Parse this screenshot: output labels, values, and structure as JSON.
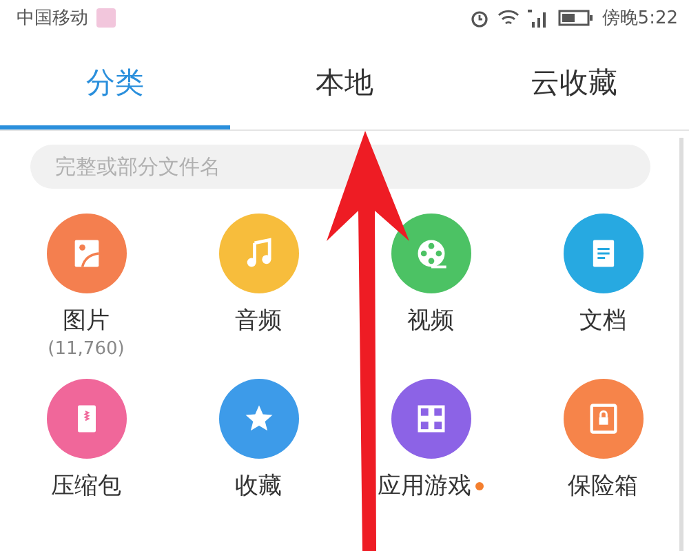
{
  "status_bar": {
    "carrier": "中国移动",
    "time": "傍晚5:22"
  },
  "tabs": [
    {
      "label": "分类",
      "selected": true
    },
    {
      "label": "本地",
      "selected": false
    },
    {
      "label": "云收藏",
      "selected": false
    }
  ],
  "search": {
    "placeholder": "完整或部分文件名"
  },
  "categories": [
    {
      "kind": "image",
      "label": "图片",
      "count": "(11,760)",
      "color": "#f47f4f",
      "new_badge": false
    },
    {
      "kind": "music",
      "label": "音频",
      "color": "#f7bd3c",
      "new_badge": false
    },
    {
      "kind": "video",
      "label": "视频",
      "color": "#4cc264",
      "new_badge": false
    },
    {
      "kind": "document",
      "label": "文档",
      "color": "#27a9e1",
      "new_badge": false
    },
    {
      "kind": "archive",
      "label": "压缩包",
      "color": "#f0679a",
      "new_badge": false
    },
    {
      "kind": "star",
      "label": "收藏",
      "color": "#3d9be9",
      "new_badge": false
    },
    {
      "kind": "apps",
      "label": "应用游戏",
      "color": "#8c63e6",
      "new_badge": true
    },
    {
      "kind": "safe",
      "label": "保险箱",
      "color": "#f6844a",
      "new_badge": false
    }
  ]
}
